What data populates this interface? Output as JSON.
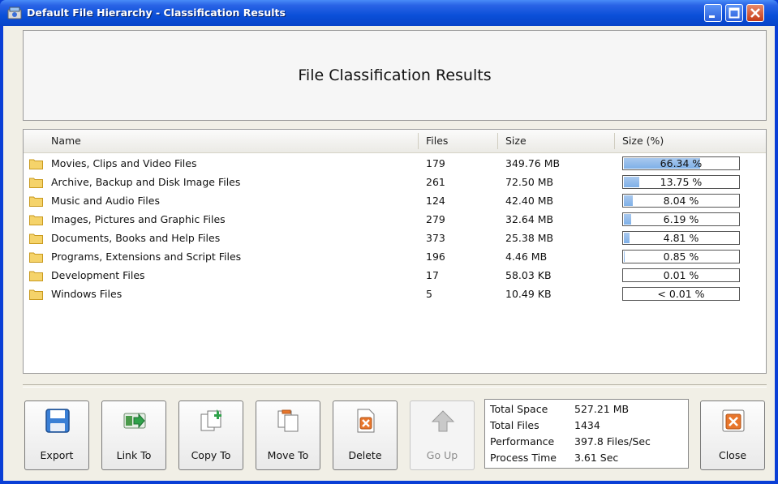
{
  "window": {
    "title": "Default File Hierarchy - Classification Results"
  },
  "header": {
    "heading": "File Classification Results"
  },
  "columns": {
    "name": "Name",
    "files": "Files",
    "size": "Size",
    "size_pct": "Size (%)"
  },
  "rows": [
    {
      "name": "Movies, Clips and Video Files",
      "files": "179",
      "size": "349.76 MB",
      "pct_label": "66.34 %",
      "pct": 66.34
    },
    {
      "name": "Archive, Backup and Disk Image Files",
      "files": "261",
      "size": "72.50 MB",
      "pct_label": "13.75 %",
      "pct": 13.75
    },
    {
      "name": "Music and Audio Files",
      "files": "124",
      "size": "42.40 MB",
      "pct_label": "8.04 %",
      "pct": 8.04
    },
    {
      "name": "Images, Pictures and Graphic Files",
      "files": "279",
      "size": "32.64 MB",
      "pct_label": "6.19 %",
      "pct": 6.19
    },
    {
      "name": "Documents, Books and Help Files",
      "files": "373",
      "size": "25.38 MB",
      "pct_label": "4.81 %",
      "pct": 4.81
    },
    {
      "name": "Programs, Extensions and Script Files",
      "files": "196",
      "size": "4.46 MB",
      "pct_label": "0.85 %",
      "pct": 0.85
    },
    {
      "name": "Development Files",
      "files": "17",
      "size": "58.03 KB",
      "pct_label": "0.01 %",
      "pct": 0.01
    },
    {
      "name": "Windows Files",
      "files": "5",
      "size": "10.49 KB",
      "pct_label": "< 0.01 %",
      "pct": 0.0
    }
  ],
  "toolbar": {
    "export": "Export",
    "link_to": "Link To",
    "copy_to": "Copy To",
    "move_to": "Move To",
    "delete": "Delete",
    "go_up": "Go Up",
    "close": "Close"
  },
  "stats": {
    "total_space_label": "Total Space",
    "total_space": "527.21 MB",
    "total_files_label": "Total Files",
    "total_files": "1434",
    "performance_label": "Performance",
    "performance": "397.8 Files/Sec",
    "process_time_label": "Process Time",
    "process_time": "3.61 Sec"
  },
  "colors": {
    "titlebar": "#0a4fd8",
    "progress_fill": "#7fb0e8",
    "folder": "#f2c94c"
  }
}
